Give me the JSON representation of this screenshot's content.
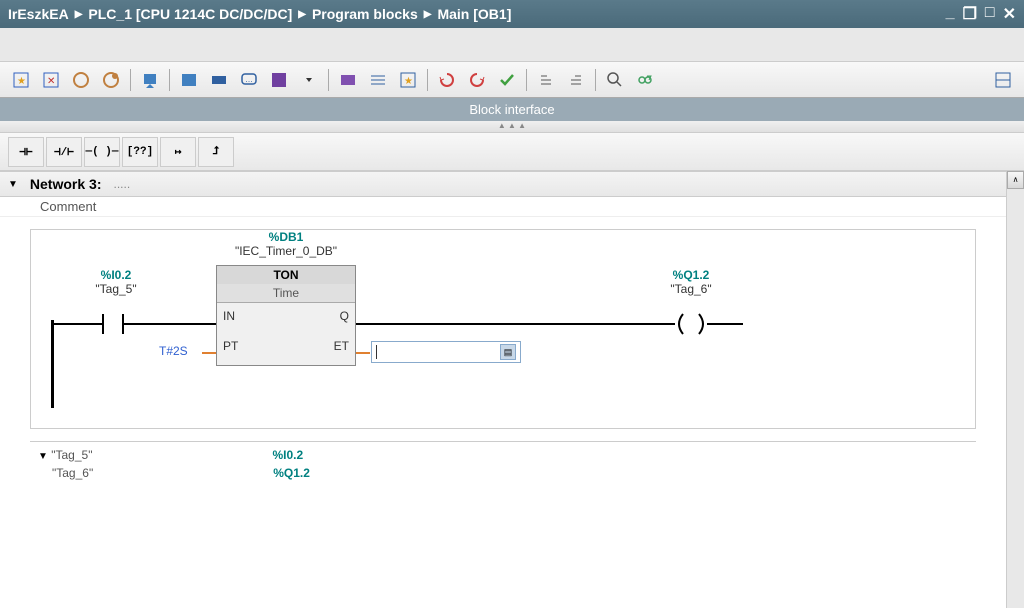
{
  "breadcrumb": {
    "items": [
      "IrEszkEA",
      "PLC_1 [CPU 1214C DC/DC/DC]",
      "Program blocks",
      "Main [OB1]"
    ]
  },
  "block_interface_label": "Block interface",
  "ladder_buttons": [
    "⊣⊢",
    "⊣/⊢",
    "⟶○⟵",
    "⁇",
    "↦",
    "↥"
  ],
  "network": {
    "title": "Network 3:",
    "title_dots": ".....",
    "comment_label": "Comment"
  },
  "ladder": {
    "db_addr": "%DB1",
    "db_name": "\"IEC_Timer_0_DB\"",
    "block_type": "TON",
    "block_sub": "Time",
    "pins": {
      "in": "IN",
      "q": "Q",
      "pt": "PT",
      "et": "ET"
    },
    "pt_value": "T#2S",
    "et_value": "",
    "input_contact": {
      "addr": "%I0.2",
      "name": "\"Tag_5\""
    },
    "output_coil": {
      "addr": "%Q1.2",
      "name": "\"Tag_6\""
    }
  },
  "crossref": [
    {
      "tag": "\"Tag_5\"",
      "addr": "%I0.2"
    },
    {
      "tag": "\"Tag_6\"",
      "addr": "%Q1.2"
    }
  ]
}
